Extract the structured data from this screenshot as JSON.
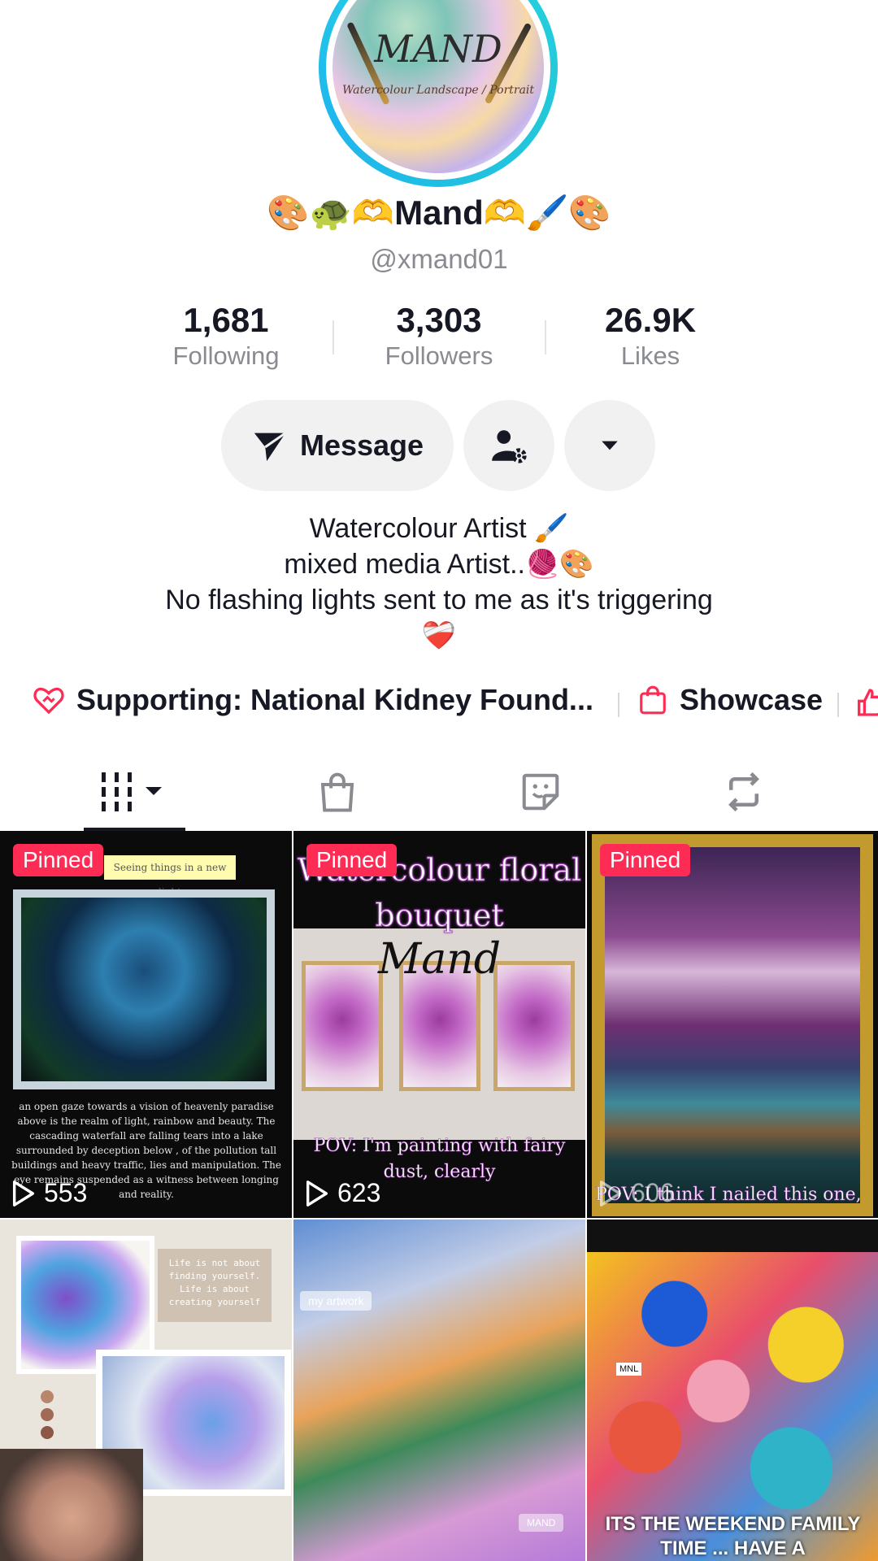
{
  "profile": {
    "name": "🎨🐢🫶Mand🫶🖌️🎨",
    "handle": "@xmand01",
    "avatar_logo": "MAND",
    "avatar_tagline": "Watercolour Landscape / Portrait"
  },
  "stats": [
    {
      "value": "1,681",
      "label": "Following"
    },
    {
      "value": "3,303",
      "label": "Followers"
    },
    {
      "value": "26.9K",
      "label": "Likes"
    }
  ],
  "actions": {
    "message_label": "Message",
    "follow_icon": "person-gear-icon",
    "more_icon": "caret-down-icon"
  },
  "bio": {
    "line1": "Watercolour Artist 🖌️",
    "line2": "mixed media Artist..🧶🎨",
    "line3": "No flashing lights sent to me as it's triggering",
    "line4": "❤️‍🩹"
  },
  "links": {
    "supporting": "Supporting: National Kidney Found...",
    "showcase": "Showcase"
  },
  "tabs": [
    {
      "icon": "grid-icon",
      "active": true
    },
    {
      "icon": "shopping-bag-icon",
      "active": false
    },
    {
      "icon": "sticker-icon",
      "active": false
    },
    {
      "icon": "repost-icon",
      "active": false
    }
  ],
  "videos": [
    {
      "pinned": "Pinned",
      "views": "553",
      "overlay_top": "Seeing things in a new light",
      "overlay_caption": "an open gaze towards a vision of heavenly paradise above is the realm of light, rainbow and beauty. The cascading waterfall are falling tears into a lake surrounded by deception below , of the pollution tall buildings and heavy traffic, lies and manipulation. The eye remains suspended as a witness between longing and reality."
    },
    {
      "pinned": "Pinned",
      "views": "623",
      "overlay_title": "Watercolour floral bouquet",
      "overlay_script": "Mand",
      "overlay_pov": "POV: I'm painting with fairy dust, clearly"
    },
    {
      "pinned": "Pinned",
      "views": "606",
      "overlay_pov": "POV: I think I nailed this one,"
    },
    {
      "overlay_note": "Life is not about finding yourself. Life is about creating yourself"
    },
    {
      "overlay_tag": "my artwork",
      "overlay_mark": "MAND"
    },
    {
      "overlay_badge": "MNL",
      "overlay_text": "ITS THE WEEKEND FAMILY TIME ... HAVE A"
    }
  ],
  "colors": {
    "accent": "#fe2c55",
    "ring": "#25d4e0",
    "text": "#161823",
    "muted": "#8a8b91"
  }
}
